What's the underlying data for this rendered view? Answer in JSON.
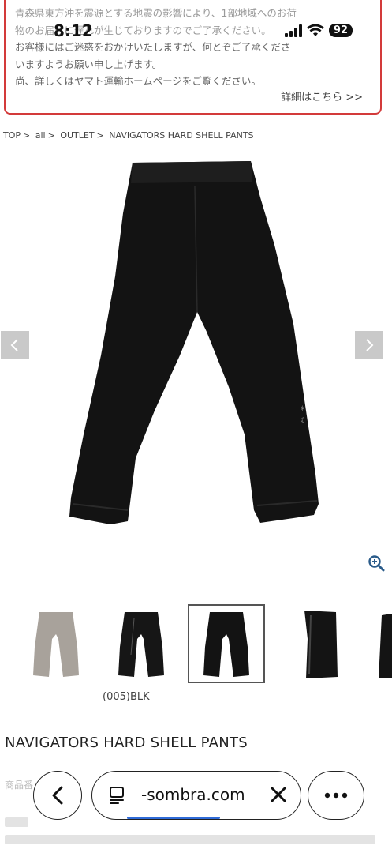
{
  "status": {
    "time": "8:12",
    "battery": "92"
  },
  "notice": {
    "line1": "青森県東方沖を震源とする地震の影響により、1部地域へのお荷",
    "line2": "物のお届けに遅れが生じておりますのでご了承ください。",
    "line3": "お客様にはご迷惑をおかけいたしますが、何とぞご了承くださ",
    "line4": "いますようお願い申し上げます。",
    "line5": "尚、詳しくはヤマト運輸ホームページをご覧ください。",
    "more_link": "詳細はこちら >>",
    "border_color": "#d33a3a"
  },
  "breadcrumb": {
    "items": [
      "TOP",
      "all",
      "OUTLET",
      "NAVIGATORS HARD SHELL PANTS"
    ],
    "separator": ">"
  },
  "gallery": {
    "prev_icon": "chevron-left-icon",
    "next_icon": "chevron-right-icon",
    "zoom_icon": "zoom-in-icon",
    "thumbnails": [
      "thumb-beige",
      "thumb-black-side",
      "thumb-black-front",
      "thumb-black-detail",
      "thumb-partial"
    ],
    "selected_index": 2
  },
  "product": {
    "color_label": "(005)BLK",
    "title": "NAVIGATORS HARD SHELL PANTS",
    "code_label": "商品番"
  },
  "browser": {
    "url": "-sombra.com",
    "back_icon": "chevron-left-icon",
    "tabs_icon": "tabs-icon",
    "close_icon": "close-icon",
    "more_icon": "more-icon",
    "accent": "#2f6bd8"
  }
}
